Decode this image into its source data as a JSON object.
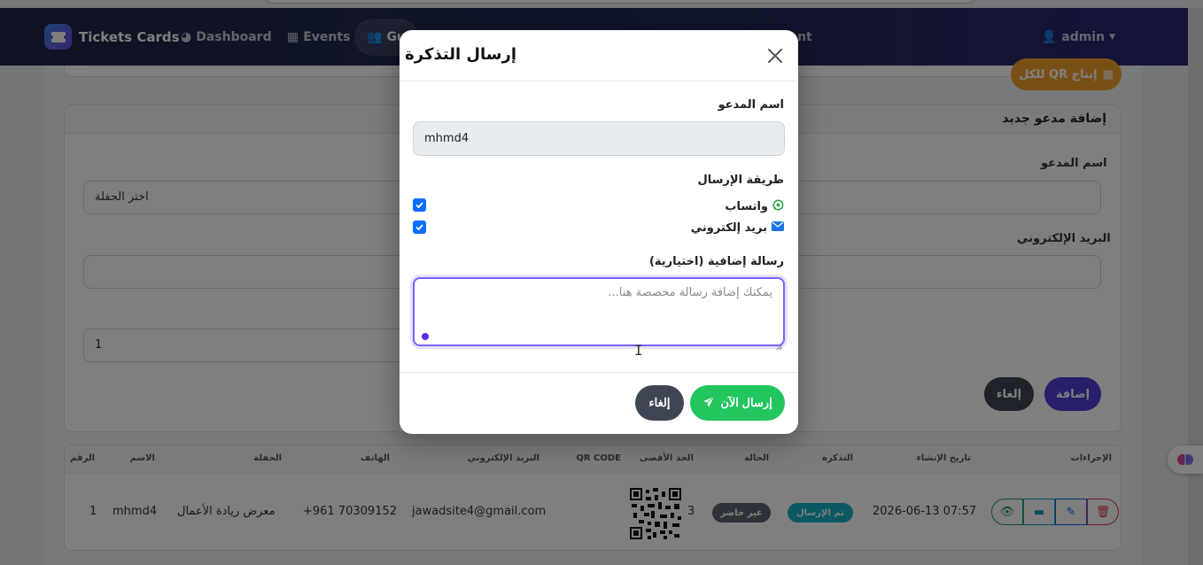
{
  "navbar": {
    "brand": "Tickets Cards",
    "links": [
      {
        "label": "Dashboard",
        "icon": "palette-icon"
      },
      {
        "label": "Events",
        "icon": "calendar-icon"
      },
      {
        "label": "Gu",
        "icon": "users-icon"
      },
      {
        "label": "ment",
        "icon": ""
      }
    ],
    "user": "admin"
  },
  "background": {
    "qr_all_button": "للكل QR إنتاج",
    "form": {
      "title": "إضافة مدعو جديد",
      "name_label": "اسم المدعو",
      "email_label": "البريد الإلكتروني",
      "event_select": "اختر الحفلة",
      "max_value": "1",
      "add_button": "إضافة",
      "cancel_button": "إلغاء"
    },
    "table": {
      "headers": [
        "الإجراءات",
        "تاريخ الإنشاء",
        "التذكرة",
        "الحالة",
        "الحد الأقصى",
        "QR CODE",
        "البريد الإلكتروني",
        "الهاتف",
        "الحفلة",
        "الاسم",
        "الرقم"
      ],
      "row": {
        "created": "2026-06-13 07:57",
        "ticket": "تم الإرسال",
        "status": "غير حاضر",
        "max": "3",
        "email": "jawadsite4@gmail.com",
        "phone": "+961 70309152",
        "event": "معرض ريادة الأعمال",
        "name": "mhmd4",
        "number": "1"
      }
    }
  },
  "modal": {
    "title": "إرسال التذكرة",
    "guest_name_label": "اسم المدعو",
    "guest_name_value": "mhmd4",
    "method_label": "طريقة الإرسال",
    "whatsapp_label": "واتساب",
    "whatsapp_checked": true,
    "email_label": "بريد إلكتروني",
    "email_checked": true,
    "extra_message_label": "رسالة إضافية (اختيارية)",
    "extra_message_placeholder": "يمكنك إضافة رسالة مخصصة هنا...",
    "send_button": "إرسال الآن",
    "cancel_button": "إلغاء"
  },
  "colors": {
    "send": "#22c55e",
    "cancel": "#3f4553",
    "checkbox": "#0d6efd",
    "focus": "#7b61ff"
  }
}
